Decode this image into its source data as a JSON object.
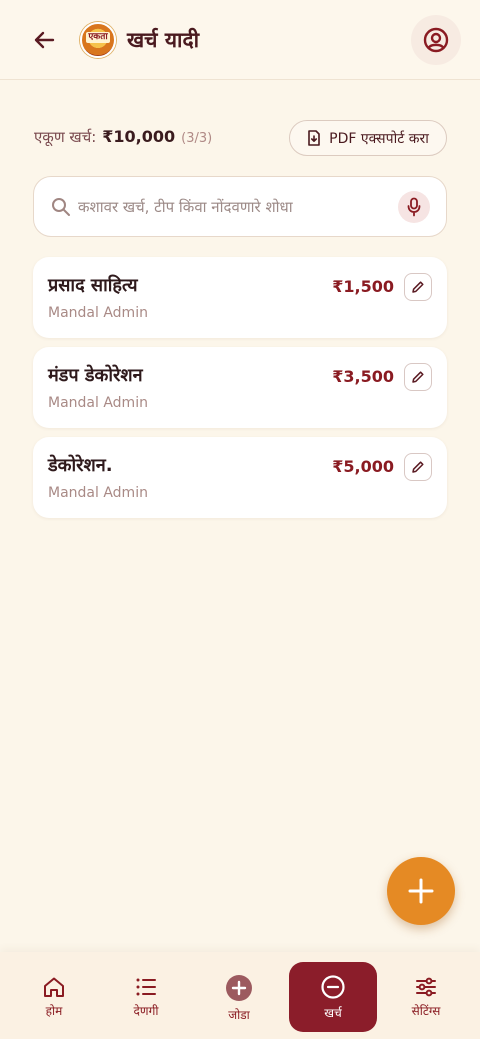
{
  "header": {
    "title": "खर्च यादी",
    "logo_text": "एकता"
  },
  "summary": {
    "label": "एकूण खर्च:",
    "amount": "₹10,000",
    "count": "(3/3)",
    "pdf_label": "PDF एक्सपोर्ट करा"
  },
  "search": {
    "placeholder": "कशावर खर्च, टीप किंवा नोंदवणारे शोधा",
    "value": ""
  },
  "expenses": [
    {
      "title": "प्रसाद साहित्य",
      "by": "Mandal Admin",
      "amount": "₹1,500"
    },
    {
      "title": "मंडप डेकोरेशन",
      "by": "Mandal Admin",
      "amount": "₹3,500"
    },
    {
      "title": "डेकोरेशन.",
      "by": "Mandal Admin",
      "amount": "₹5,000"
    }
  ],
  "nav": {
    "home": "होम",
    "donations": "देणगी",
    "add": "जोडा",
    "expenses": "खर्च",
    "settings": "सेटिंग्स"
  },
  "colors": {
    "accent": "#8b1d2a",
    "fab": "#e58a24",
    "background": "#fcf6ea"
  }
}
